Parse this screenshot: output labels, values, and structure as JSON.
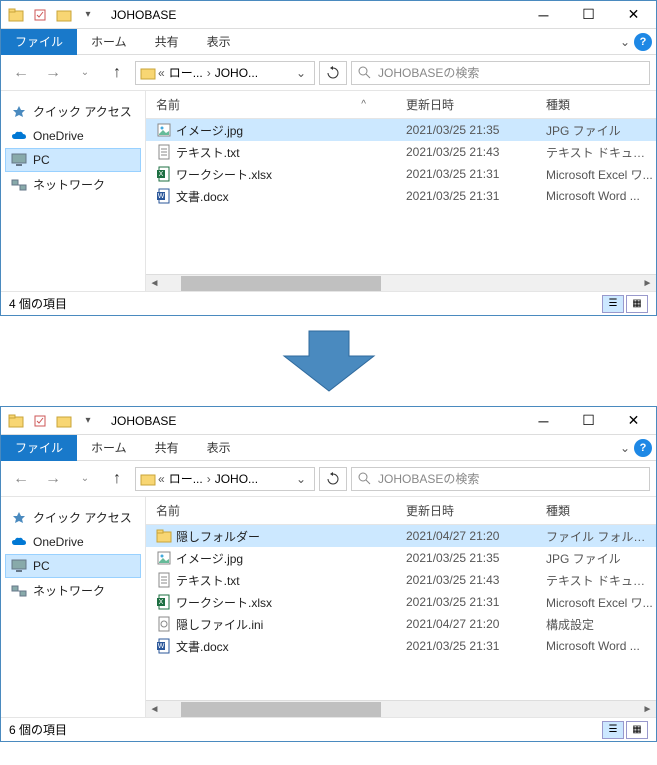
{
  "window1": {
    "title": "JOHOBASE",
    "tabs": {
      "file": "ファイル",
      "home": "ホーム",
      "share": "共有",
      "view": "表示"
    },
    "breadcrumb": {
      "root": "ロー...",
      "current": "JOHO..."
    },
    "search_placeholder": "JOHOBASEの検索",
    "columns": {
      "name": "名前",
      "date": "更新日時",
      "type": "種類"
    },
    "sidebar": {
      "quick": "クイック アクセス",
      "onedrive": "OneDrive",
      "pc": "PC",
      "network": "ネットワーク"
    },
    "files": [
      {
        "name": "イメージ.jpg",
        "date": "2021/03/25 21:35",
        "type": "JPG ファイル",
        "icon": "img",
        "sel": true
      },
      {
        "name": "テキスト.txt",
        "date": "2021/03/25 21:43",
        "type": "テキスト ドキュメント",
        "icon": "txt",
        "sel": false
      },
      {
        "name": "ワークシート.xlsx",
        "date": "2021/03/25 21:31",
        "type": "Microsoft Excel ワ...",
        "icon": "xls",
        "sel": false
      },
      {
        "name": "文書.docx",
        "date": "2021/03/25 21:31",
        "type": "Microsoft Word ...",
        "icon": "doc",
        "sel": false
      }
    ],
    "status": "4 個の項目"
  },
  "window2": {
    "title": "JOHOBASE",
    "tabs": {
      "file": "ファイル",
      "home": "ホーム",
      "share": "共有",
      "view": "表示"
    },
    "breadcrumb": {
      "root": "ロー...",
      "current": "JOHO..."
    },
    "search_placeholder": "JOHOBASEの検索",
    "columns": {
      "name": "名前",
      "date": "更新日時",
      "type": "種類"
    },
    "sidebar": {
      "quick": "クイック アクセス",
      "onedrive": "OneDrive",
      "pc": "PC",
      "network": "ネットワーク"
    },
    "files": [
      {
        "name": "隠しフォルダー",
        "date": "2021/04/27 21:20",
        "type": "ファイル フォルダー",
        "icon": "folder",
        "sel": true
      },
      {
        "name": "イメージ.jpg",
        "date": "2021/03/25 21:35",
        "type": "JPG ファイル",
        "icon": "img",
        "sel": false
      },
      {
        "name": "テキスト.txt",
        "date": "2021/03/25 21:43",
        "type": "テキスト ドキュメント",
        "icon": "txt",
        "sel": false
      },
      {
        "name": "ワークシート.xlsx",
        "date": "2021/03/25 21:31",
        "type": "Microsoft Excel ワ...",
        "icon": "xls",
        "sel": false
      },
      {
        "name": "隠しファイル.ini",
        "date": "2021/04/27 21:20",
        "type": "構成設定",
        "icon": "ini",
        "sel": false
      },
      {
        "name": "文書.docx",
        "date": "2021/03/25 21:31",
        "type": "Microsoft Word ...",
        "icon": "doc",
        "sel": false
      }
    ],
    "status": "6 個の項目"
  },
  "icons": {
    "folder_color": "#f8d673",
    "star_color": "#4a8abf"
  }
}
